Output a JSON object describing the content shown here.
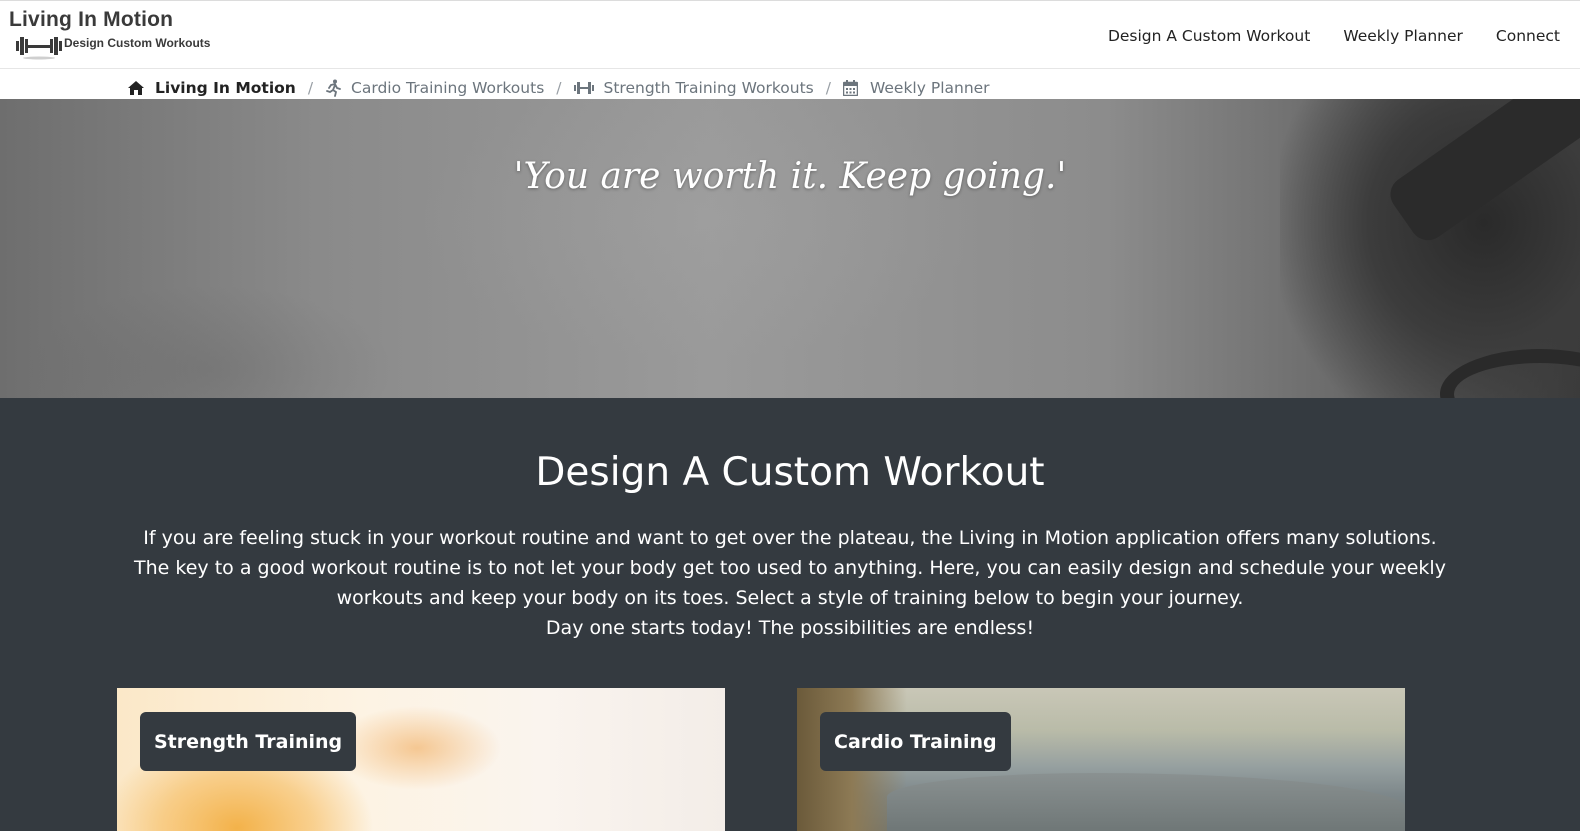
{
  "brand": {
    "title": "Living In Motion",
    "subtitle": "Design Custom Workouts",
    "icon": "barbell-icon"
  },
  "nav": {
    "links": [
      "Design A Custom Workout",
      "Weekly Planner",
      "Connect"
    ]
  },
  "breadcrumb": {
    "items": [
      {
        "label": "Living In Motion",
        "icon": "home-icon",
        "active": true
      },
      {
        "label": "Cardio Training Workouts",
        "icon": "running-icon",
        "active": false
      },
      {
        "label": "Strength Training Workouts",
        "icon": "dumbbell-icon",
        "active": false
      },
      {
        "label": "Weekly Planner",
        "icon": "calendar-icon",
        "active": false
      }
    ],
    "separator": "/"
  },
  "hero": {
    "quote": "'You are worth it. Keep going.'"
  },
  "section": {
    "title": "Design A Custom Workout",
    "paragraphs": [
      "If you are feeling stuck in your workout routine and want to get over the plateau, the Living in Motion application offers many solutions.",
      "The key to a good workout routine is to not let your body get too used to anything. Here, you can easily design and schedule your weekly workouts and keep your body on its toes. Select a style of training below to begin your journey.",
      "Day one starts today! The possibilities are endless!"
    ]
  },
  "cards": [
    {
      "label": "Strength Training"
    },
    {
      "label": "Cardio Training"
    }
  ],
  "colors": {
    "section_bg": "#343a40",
    "text_light": "#ffffff",
    "breadcrumb_muted": "#6c757d"
  }
}
